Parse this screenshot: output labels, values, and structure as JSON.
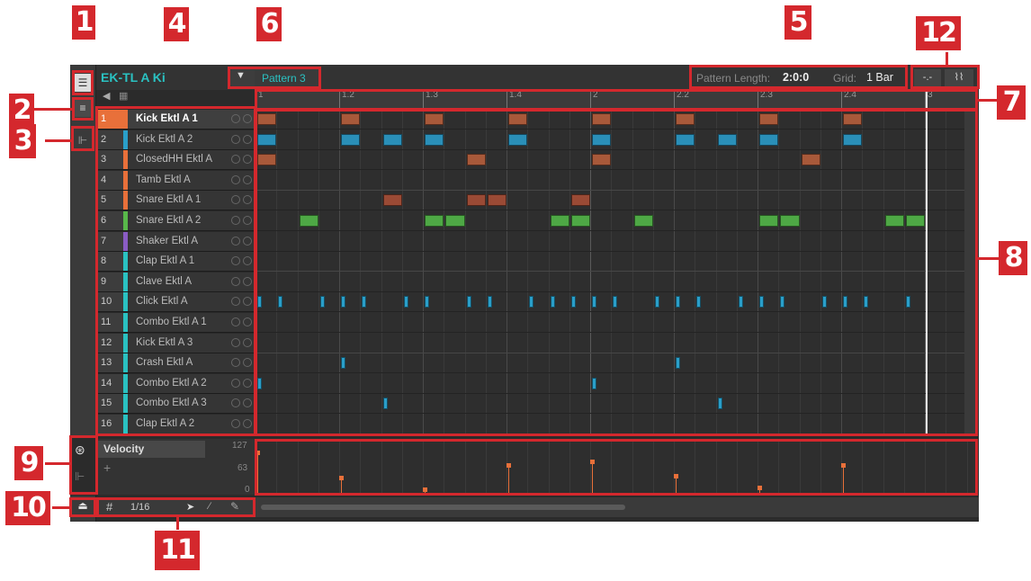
{
  "kit_name": "EK-TL A Ki",
  "pattern_name": "Pattern 3",
  "pattern_length_label": "Pattern Length:",
  "pattern_length_value": "2:0:0",
  "grid_label": "Grid:",
  "grid_value": "1 Bar",
  "ruler_labels": [
    "1",
    "1.2",
    "1.3",
    "1.4",
    "2",
    "2.2",
    "2.3",
    "2.4",
    "3"
  ],
  "sounds": [
    {
      "num": "1",
      "name": "Kick Ektl A 1",
      "color": "#e8703a"
    },
    {
      "num": "2",
      "name": "Kick Ektl A 2",
      "color": "#2a9fc9"
    },
    {
      "num": "3",
      "name": "ClosedHH Ektl A",
      "color": "#e8703a"
    },
    {
      "num": "4",
      "name": "Tamb Ektl A",
      "color": "#e8703a"
    },
    {
      "num": "5",
      "name": "Snare Ektl A 1",
      "color": "#e8703a"
    },
    {
      "num": "6",
      "name": "Snare Ektl A 2",
      "color": "#58b84a"
    },
    {
      "num": "7",
      "name": "Shaker Ektl A",
      "color": "#8a5cc4"
    },
    {
      "num": "8",
      "name": "Clap Ektl A 1",
      "color": "#2ac2c2"
    },
    {
      "num": "9",
      "name": "Clave Ektl A",
      "color": "#2ac2c2"
    },
    {
      "num": "10",
      "name": "Click Ektl A",
      "color": "#2ac2c2"
    },
    {
      "num": "11",
      "name": "Combo Ektl A 1",
      "color": "#2ac2c2"
    },
    {
      "num": "12",
      "name": "Kick Ektl A 3",
      "color": "#2ac2c2"
    },
    {
      "num": "13",
      "name": "Crash Ektl A",
      "color": "#2ac2c2"
    },
    {
      "num": "14",
      "name": "Combo Ektl A 2",
      "color": "#2ac2c2"
    },
    {
      "num": "15",
      "name": "Combo Ektl A 3",
      "color": "#2ac2c2"
    },
    {
      "num": "16",
      "name": "Clap Ektl A 2",
      "color": "#2ac2c2"
    }
  ],
  "velocity": {
    "label": "Velocity",
    "add": "+",
    "max": "127",
    "mid": "63",
    "min": "0"
  },
  "footer": {
    "step": "1/16"
  },
  "callouts": [
    "1",
    "2",
    "3",
    "4",
    "5",
    "6",
    "7",
    "8",
    "9",
    "10",
    "11",
    "12"
  ]
}
